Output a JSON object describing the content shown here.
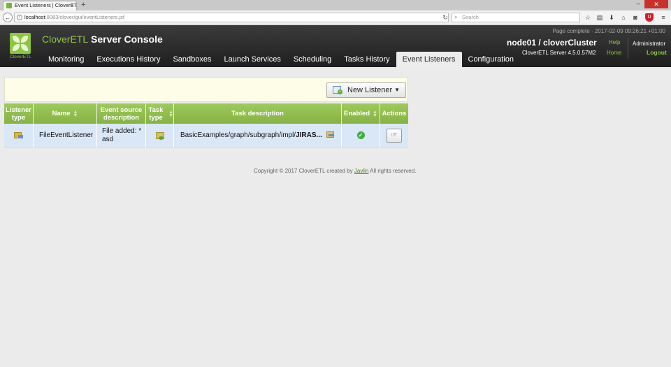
{
  "browser": {
    "tab_title": "Event Listeners | CloverETL ...",
    "tab_close": "×",
    "new_tab": "+",
    "url_host": "localhost",
    "url_path": ":8083/clover/gui/eventListeners.jsf",
    "search_placeholder": "Search",
    "window_minimize": "–",
    "window_close": "✕"
  },
  "header": {
    "logo_caption": "CloverETL",
    "title_brand": "CloverETL",
    "title_rest": " Server Console",
    "page_complete": "Page complete · 2017-02-09 09:26:21 +01:00",
    "node_title": "node01 / cloverCluster",
    "server_version": "CloverETL Server 4.5.0.57M2",
    "help": "Help",
    "home": "Home",
    "user": "Administrator",
    "logout": "Logout"
  },
  "nav": {
    "items": [
      {
        "label": "Monitoring"
      },
      {
        "label": "Executions History"
      },
      {
        "label": "Sandboxes"
      },
      {
        "label": "Launch Services"
      },
      {
        "label": "Scheduling"
      },
      {
        "label": "Tasks History"
      },
      {
        "label": "Event Listeners"
      },
      {
        "label": "Configuration"
      }
    ],
    "active": "Event Listeners"
  },
  "toolbar": {
    "new_listener_label": "New Listener"
  },
  "table": {
    "columns": [
      {
        "label": "Listener type"
      },
      {
        "label": "Name"
      },
      {
        "label": "Event source description"
      },
      {
        "label": "Task type"
      },
      {
        "label": "Task description"
      },
      {
        "label": "Enabled"
      },
      {
        "label": "Actions"
      }
    ],
    "rows": [
      {
        "listener_type_icon": "file-listener-icon",
        "name": "FileEventListener",
        "event_source": "File added: * asd",
        "task_type_icon": "execute-graph-icon",
        "task_description_prefix": "BasicExamples/graph/subgraph/impl/",
        "task_description_bold": "JIRAS...",
        "enabled": true
      }
    ]
  },
  "footer": {
    "copyright_prefix": "Copyright © 2017 CloverETL created by ",
    "company": "Javlin",
    "copyright_suffix": " All rights reserved."
  }
}
